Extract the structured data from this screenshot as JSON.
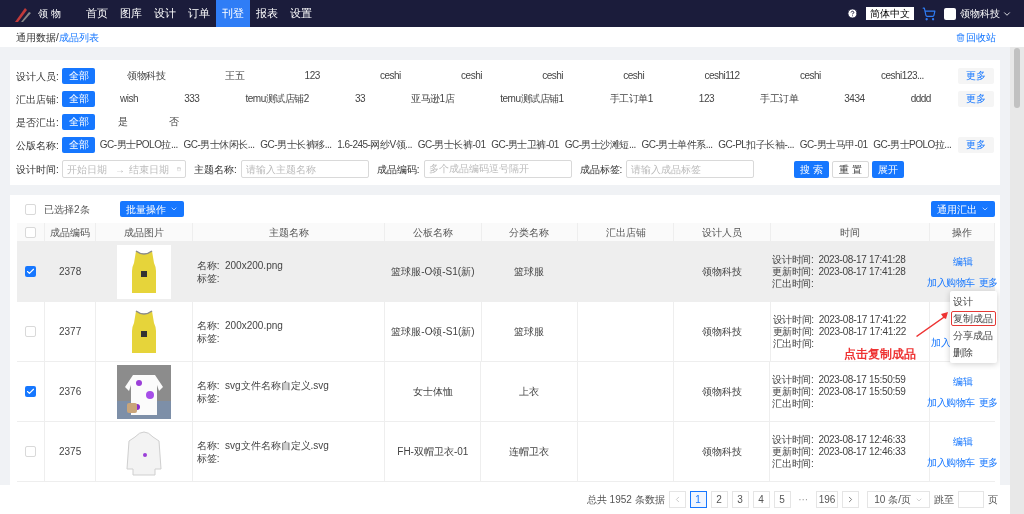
{
  "nav": {
    "logo": "领 物",
    "items": [
      {
        "label": "首页",
        "selected": false
      },
      {
        "label": "图库",
        "selected": false
      },
      {
        "label": "设计",
        "selected": false
      },
      {
        "label": "订单",
        "selected": false
      },
      {
        "label": "刊登",
        "selected": true
      },
      {
        "label": "报表",
        "selected": false
      },
      {
        "label": "设置",
        "selected": false
      }
    ],
    "language": "简体中文",
    "user": "领物科技"
  },
  "breadcrumb": {
    "separator": "/",
    "items": [
      {
        "label": "通用数据",
        "current": false
      },
      {
        "label": "成品列表",
        "current": true
      }
    ]
  },
  "recycle": "回收站",
  "filters": [
    {
      "label": "设计人员:",
      "more": "更多",
      "options": [
        {
          "label": "全部",
          "selected": true
        },
        {
          "label": "领物科技",
          "selected": false
        },
        {
          "label": "王五",
          "selected": false
        },
        {
          "label": "123",
          "selected": false
        },
        {
          "label": "ceshi",
          "selected": false
        },
        {
          "label": "ceshi",
          "selected": false
        },
        {
          "label": "ceshi",
          "selected": false
        },
        {
          "label": "ceshi",
          "selected": false
        },
        {
          "label": "ceshi112",
          "selected": false
        },
        {
          "label": "ceshi",
          "selected": false
        },
        {
          "label": "ceshi123...",
          "selected": false
        }
      ]
    },
    {
      "label": "汇出店铺:",
      "more": "更多",
      "options": [
        {
          "label": "全部",
          "selected": true
        },
        {
          "label": "wish",
          "selected": false
        },
        {
          "label": "333",
          "selected": false
        },
        {
          "label": "temu测试店铺2",
          "selected": false
        },
        {
          "label": "33",
          "selected": false
        },
        {
          "label": "亚马逊1店",
          "selected": false
        },
        {
          "label": "temu测试店铺1",
          "selected": false
        },
        {
          "label": "手工订单1",
          "selected": false
        },
        {
          "label": "123",
          "selected": false
        },
        {
          "label": "手工订单",
          "selected": false
        },
        {
          "label": "3434",
          "selected": false
        },
        {
          "label": "dddd",
          "selected": false
        }
      ]
    },
    {
      "label": "是否汇出:",
      "options": [
        {
          "label": "全部",
          "selected": true
        },
        {
          "label": "是",
          "selected": false
        },
        {
          "label": "否",
          "selected": false
        }
      ]
    },
    {
      "label": "公版名称:",
      "more": "更多",
      "options": [
        {
          "label": "全部",
          "selected": true
        },
        {
          "label": "GC-男士POLO拉...",
          "selected": false
        },
        {
          "label": "GC-男士休闲长...",
          "selected": false
        },
        {
          "label": "GC-男士长裤移...",
          "selected": false
        },
        {
          "label": "1.6-245-网纱V领...",
          "selected": false
        },
        {
          "label": "GC-男士长裤-01",
          "selected": false
        },
        {
          "label": "GC-男士卫裤-01",
          "selected": false
        },
        {
          "label": "GC-男士沙滩短...",
          "selected": false
        },
        {
          "label": "GC-男士单件系...",
          "selected": false
        },
        {
          "label": "GC-PL扣子长袖-...",
          "selected": false
        },
        {
          "label": "GC-男士马甲-01",
          "selected": false
        },
        {
          "label": "GC-男士POLO拉...",
          "selected": false
        }
      ]
    }
  ],
  "search": {
    "date": {
      "label": "设计时间:",
      "start_placeholder": "开始日期",
      "end_placeholder": "结束日期",
      "separator": "→"
    },
    "theme": {
      "label": "主题名称:",
      "placeholder": "请输入主题名称"
    },
    "code": {
      "label": "成品编码:",
      "placeholder": "多个成品编码逗号隔开"
    },
    "tag": {
      "label": "成品标签:",
      "placeholder": "请输入成品标签"
    },
    "buttons": [
      {
        "label": "搜 索",
        "kind": "primary"
      },
      {
        "label": "重 置",
        "kind": "default"
      },
      {
        "label": "展开",
        "kind": "primary"
      }
    ]
  },
  "toolbar": {
    "select_all": false,
    "selected_count": "已选择2条",
    "batch": "批量操作",
    "export": "通用汇出"
  },
  "table": {
    "header_checked": false,
    "columns": [
      "成品编码",
      "成品图片",
      "主题名称",
      "公板名称",
      "分类名称",
      "汇出店铺",
      "设计人员",
      "时间",
      "操作"
    ],
    "rows": [
      {
        "checked": true,
        "highlighted": true,
        "code": "2378",
        "name": "名称:  200x200.png",
        "tag": "标签:",
        "template": "篮球服-O领-S1(新)",
        "category": "篮球服",
        "designer": "领物科技",
        "design_time": "设计时间:  2023-08-17 17:41:28",
        "update_time": "更新时间:  2023-08-17 17:41:28",
        "export_time": "汇出时间:",
        "edit": "编辑",
        "cart": "加入购物车",
        "more": "更多"
      },
      {
        "checked": false,
        "highlighted": false,
        "code": "2377",
        "name": "名称:  200x200.png",
        "tag": "标签:",
        "template": "篮球服-O领-S1(新)",
        "category": "篮球服",
        "designer": "领物科技",
        "design_time": "设计时间:  2023-08-17 17:41:22",
        "update_time": "更新时间:  2023-08-17 17:41:22",
        "export_time": "汇出时间:",
        "cart": "加入"
      },
      {
        "checked": true,
        "highlighted": false,
        "code": "2376",
        "name": "名称:  svg文件名称自定义.svg",
        "tag": "标签:",
        "template": "女士体恤",
        "category": "上衣",
        "designer": "领物科技",
        "design_time": "设计时间:  2023-08-17 15:50:59",
        "update_time": "更新时间:  2023-08-17 15:50:59",
        "export_time": "汇出时间:",
        "edit": "编辑",
        "cart": "加入购物车",
        "more": "更多"
      },
      {
        "checked": false,
        "highlighted": false,
        "code": "2375",
        "name": "名称:  svg文件名称自定义.svg",
        "tag": "标签:",
        "template": "FH-双帽卫衣-01",
        "category": "连帽卫衣",
        "designer": "领物科技",
        "design_time": "设计时间:  2023-08-17 12:46:33",
        "update_time": "更新时间:  2023-08-17 12:46:33",
        "export_time": "汇出时间:",
        "edit": "编辑",
        "cart": "加入购物车",
        "more": "更多"
      }
    ]
  },
  "menu": [
    {
      "label": "设计",
      "outlined": false
    },
    {
      "label": "复制成品",
      "outlined": true
    },
    {
      "label": "分享成品",
      "outlined": false
    },
    {
      "label": "删除",
      "outlined": false
    }
  ],
  "annotation": {
    "text": "点击复制成品",
    "color": "#ee3333"
  },
  "pagination": {
    "total": "总共 1952 条数据",
    "pages": [
      {
        "label": "1",
        "selected": true,
        "kind": "page"
      },
      {
        "label": "2",
        "selected": false,
        "kind": "page"
      },
      {
        "label": "3",
        "selected": false,
        "kind": "page"
      },
      {
        "label": "4",
        "selected": false,
        "kind": "page"
      },
      {
        "label": "5",
        "selected": false,
        "kind": "page"
      },
      {
        "label": "···",
        "kind": "ellipsis"
      },
      {
        "label": "196",
        "selected": false,
        "kind": "page"
      }
    ],
    "page_size": "10 条/页",
    "goto": "跳至",
    "suffix": "页"
  }
}
